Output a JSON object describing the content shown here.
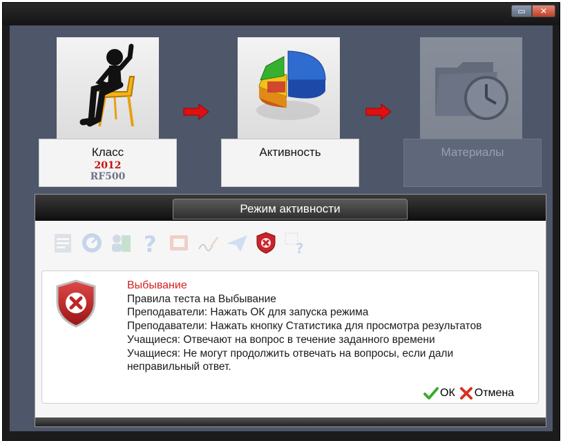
{
  "window": {
    "minimize_symbol": "▭",
    "close_symbol": "✕"
  },
  "steps": [
    {
      "name": "Класс",
      "year": "2012",
      "code": "RF500",
      "icon": "seated-figure-icon",
      "enabled": true
    },
    {
      "name": "Активность",
      "icon": "pie-chart-icon",
      "enabled": true
    },
    {
      "name": "Материалы",
      "icon": "folder-clock-icon",
      "enabled": false
    }
  ],
  "panel": {
    "title": "Режим активности",
    "toolbar_icons": [
      {
        "name": "calendar-icon",
        "active": false
      },
      {
        "name": "dial-icon",
        "active": false
      },
      {
        "name": "user-book-icon",
        "active": false
      },
      {
        "name": "question-icon",
        "active": false
      },
      {
        "name": "presentation-icon",
        "active": false
      },
      {
        "name": "signature-icon",
        "active": false
      },
      {
        "name": "paper-plane-icon",
        "active": false
      },
      {
        "name": "shield-x-icon",
        "active": true
      },
      {
        "name": "select-question-icon",
        "active": false
      }
    ]
  },
  "message": {
    "title": "Выбывание",
    "lines": [
      "Правила теста на Выбывание",
      "Преподаватели: Нажать ОК для запуска режима",
      "Преподаватели: Нажать кнопку Статистика для просмотра результатов",
      "Учащиеся: Отвечают на вопрос в течение заданного времени",
      "Учащиеся: Не могут продолжить отвечать на вопросы, если дали неправильный ответ."
    ],
    "ok_label": "ОК",
    "cancel_label": "Отмена"
  },
  "colors": {
    "accent_red": "#d42020",
    "year_red": "#c81010",
    "code_gray": "#6c7488",
    "disabled_text": "#9aa0ad",
    "background": "#4e566a"
  }
}
